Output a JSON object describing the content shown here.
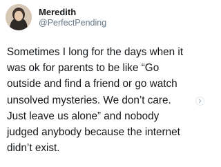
{
  "tweet": {
    "author": {
      "display_name": "Meredith",
      "handle": "@PerfectPending"
    },
    "text_lines": [
      "Sometimes I long for the days when it",
      "was ok for parents to be like “Go",
      "outside and find a friend or go watch",
      "unsolved mysteries. We don’t care.",
      "Just leave us alone” and nobody",
      "judged anybody because the internet",
      "didn’t exist."
    ],
    "more_icon": "chevron-right-icon"
  },
  "colors": {
    "text": "#14171a",
    "secondary_text": "#657786",
    "background": "#ffffff"
  }
}
